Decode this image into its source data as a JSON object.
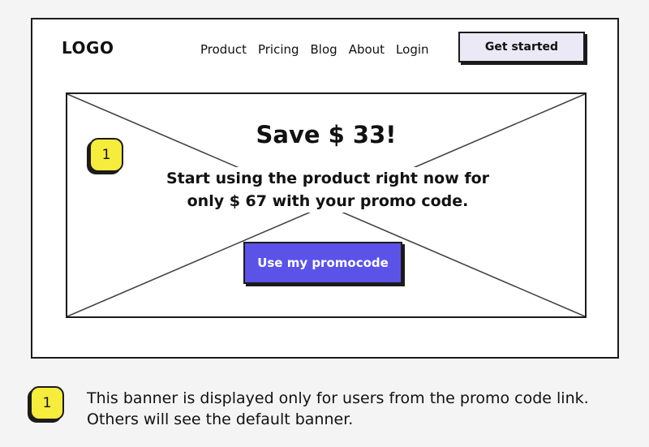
{
  "header": {
    "logo": "LOGO",
    "nav": [
      "Product",
      "Pricing",
      "Blog",
      "About",
      "Login"
    ],
    "cta_label": "Get started"
  },
  "banner": {
    "headline": "Save $ 33!",
    "subtext": "Start using the product right now for only $ 67 with your promo code.",
    "button_label": "Use my promocode"
  },
  "annotation": {
    "marker": "1",
    "note": "This banner is displayed only for users from the promo code link. Others will see the default banner."
  },
  "colors": {
    "primary_button": "#5b53e8",
    "secondary_button": "#ebe9f6",
    "marker": "#f6ec3b"
  }
}
